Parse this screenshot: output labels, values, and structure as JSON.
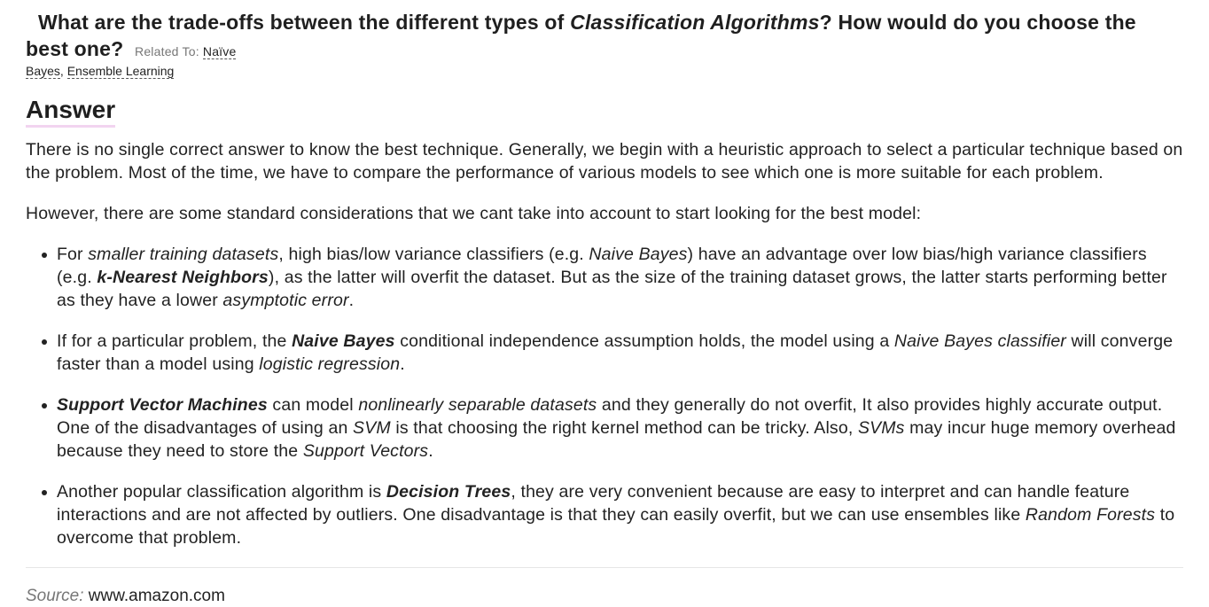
{
  "question": {
    "part1": "What are the trade-offs between the different types of ",
    "emphasis": "Classification Algorithms",
    "part2": "? How would do you choose the best one?",
    "related_label": "Related To:",
    "related_links": [
      "Naïve Bayes",
      "Ensemble Learning"
    ],
    "related_link1_line1": "Naïve",
    "related_link1_line2": "Bayes",
    "separator": ","
  },
  "answer_heading": "Answer",
  "paragraphs": [
    "There is no single correct answer to know the best technique. Generally, we begin with a heuristic approach to select a particular technique based on the problem. Most of the time, we have to compare the performance of various models to see which one is more suitable for each problem.",
    "However, there are some standard considerations that we cant take into account to start looking for the best model:"
  ],
  "bullets": [
    {
      "s1": "For ",
      "i1": "smaller training datasets",
      "s2": ", high bias/low variance classifiers (e.g. ",
      "i2": "Naive Bayes",
      "s3": ") have an advantage over low bias/high variance classifiers (e.g. ",
      "b1": "k-Nearest Neighbors",
      "s4": "), as the latter will overfit the dataset. But as the size of the training dataset grows, the latter starts performing better as they have a lower ",
      "i3": "asymptotic error",
      "s5": "."
    },
    {
      "s1": "If for a particular problem, the ",
      "b1": "Naive Bayes",
      "s2": " conditional independence assumption holds, the model using a ",
      "i1": "Naive Bayes classifier",
      "s3": " will converge faster than a model using ",
      "i2": "logistic regression",
      "s4": "."
    },
    {
      "b1": "Support Vector Machines",
      "s1": " can model ",
      "i1": "nonlinearly separable datasets",
      "s2": " and they generally do not overfit, It also provides highly accurate output. One of the disadvantages of using an ",
      "i2": "SVM",
      "s3": " is that choosing the right kernel method can be tricky. Also, ",
      "i3": "SVMs",
      "s4": " may incur huge memory overhead because they need to store the ",
      "i4": "Support Vectors",
      "s5": "."
    },
    {
      "s1": "Another popular classification algorithm is ",
      "b1": "Decision Trees",
      "s2": ", they are very convenient because are easy to interpret and can handle feature interactions and are not affected by outliers. One disadvantage is that they can easily overfit, but we can use ensembles like ",
      "i1": "Random Forests",
      "s3": " to overcome that problem."
    }
  ],
  "source": {
    "label": "Source:",
    "url": "www.amazon.com"
  }
}
